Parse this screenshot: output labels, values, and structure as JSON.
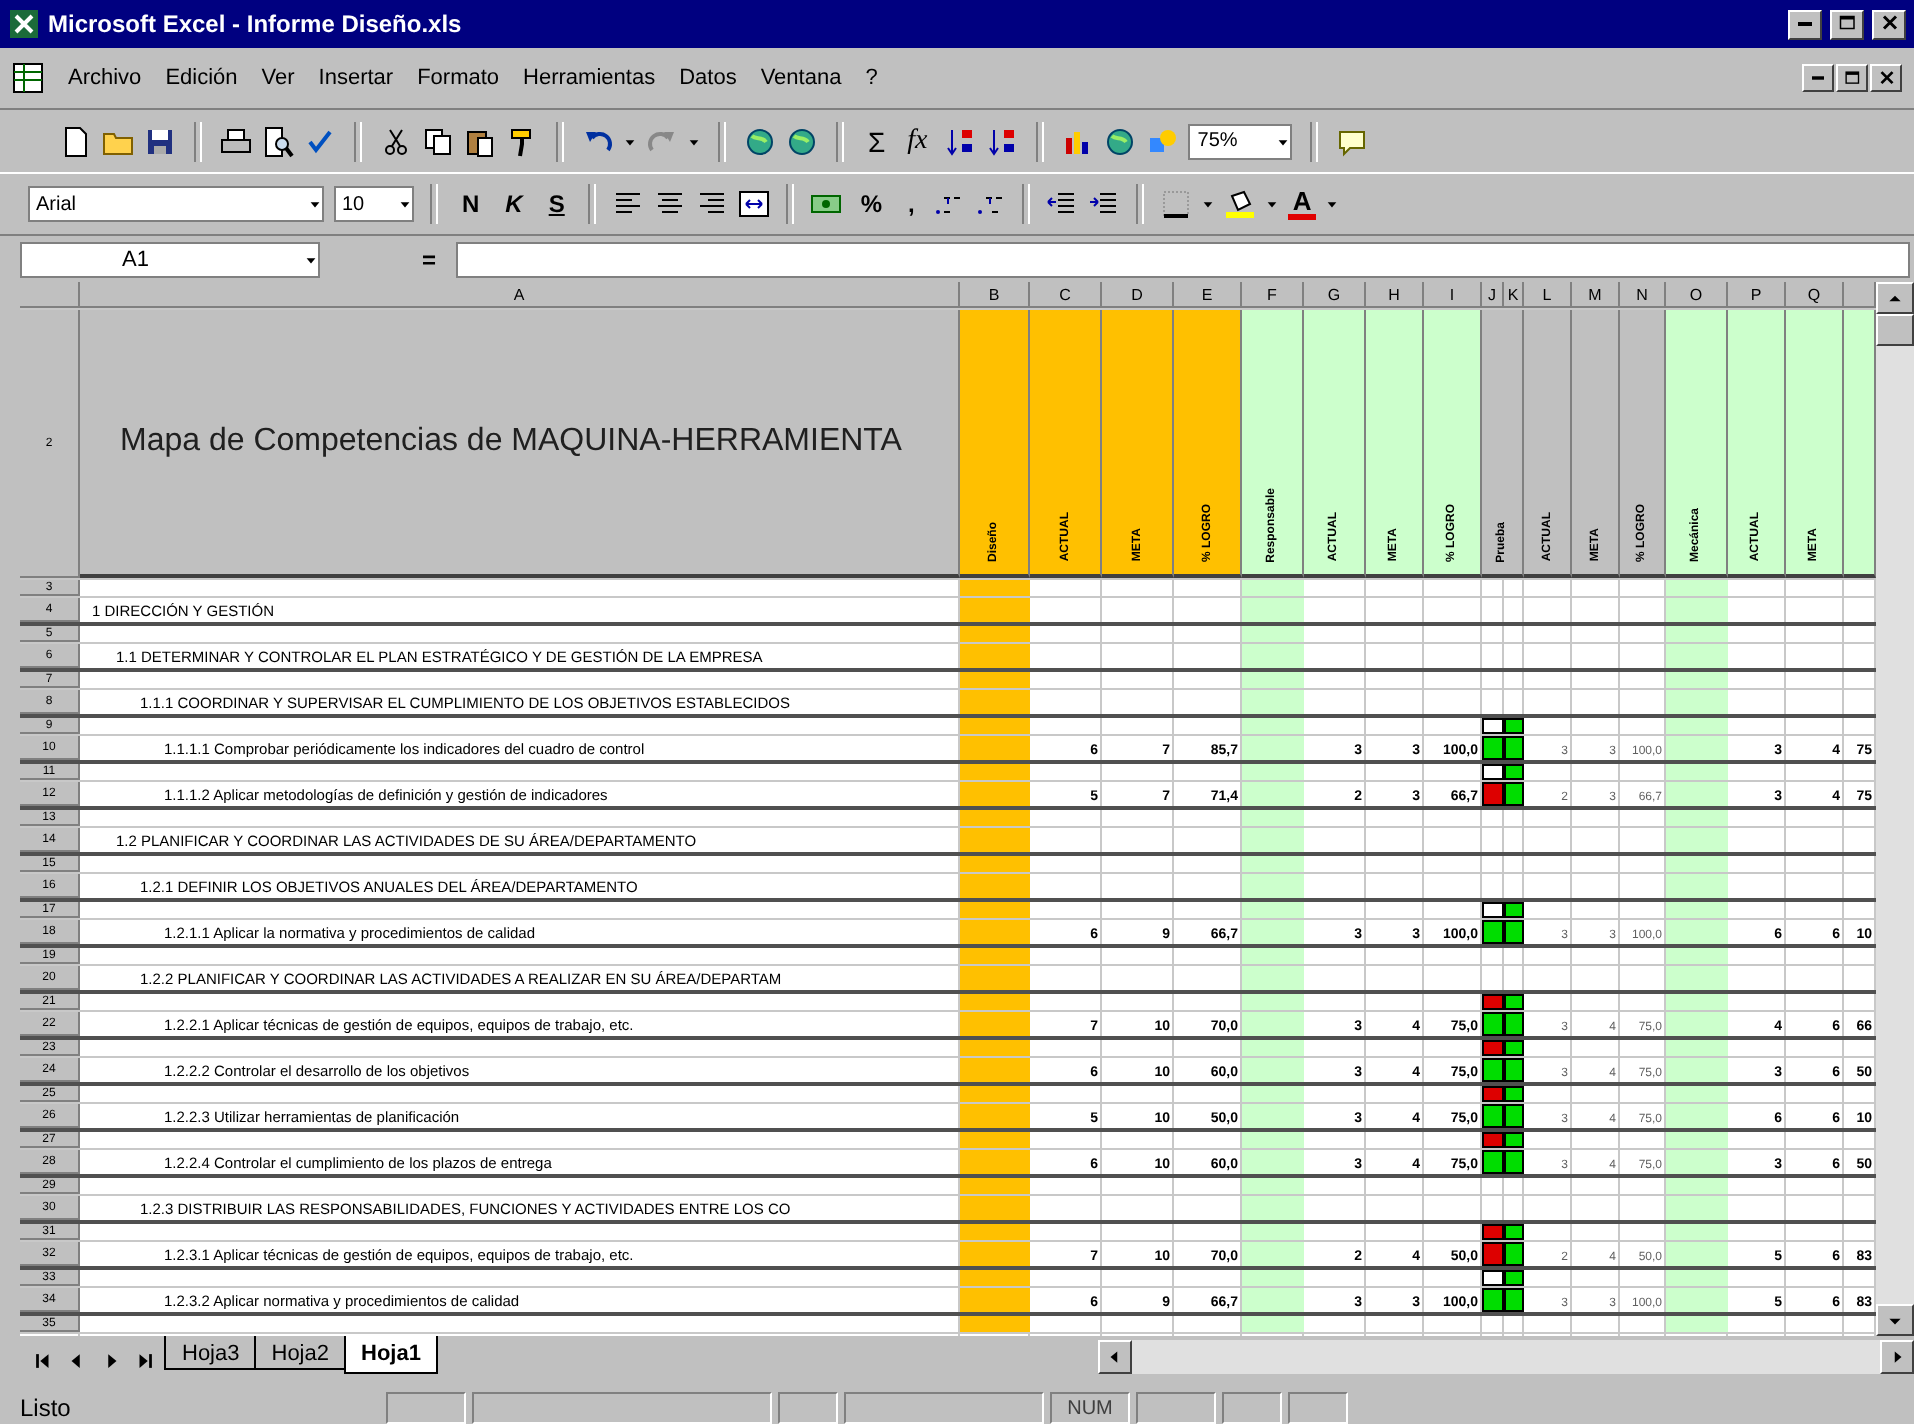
{
  "window": {
    "title": "Microsoft Excel - Informe Diseño.xls"
  },
  "menu": [
    "Archivo",
    "Edición",
    "Ver",
    "Insertar",
    "Formato",
    "Herramientas",
    "Datos",
    "Ventana",
    "?"
  ],
  "standard_toolbar": {
    "sum": "Σ",
    "function": "fx",
    "zoom": "75%"
  },
  "formatting_toolbar": {
    "font": "Arial",
    "size": "10",
    "bold": "N",
    "italic": "K",
    "underline": "S",
    "percent": "%",
    "comma": ",",
    "font_color": "A"
  },
  "formula_bar": {
    "name_box": "A1",
    "equals": "="
  },
  "sheet": {
    "columns": [
      "A",
      "B",
      "C",
      "D",
      "E",
      "F",
      "G",
      "H",
      "I",
      "J",
      "K",
      "L",
      "M",
      "N",
      "O",
      "P",
      "Q"
    ],
    "row_numbers": [
      "2",
      "3",
      "4",
      "5",
      "6",
      "7",
      "8",
      "9",
      "10",
      "11",
      "12",
      "13",
      "14",
      "15",
      "16",
      "17",
      "18",
      "19",
      "20",
      "21",
      "22",
      "23",
      "24",
      "25",
      "26",
      "27",
      "28",
      "29",
      "30",
      "31",
      "32",
      "33",
      "34",
      "35"
    ],
    "title": "Mapa de Competencias de MAQUINA-HERRAMIENTA",
    "headers": [
      {
        "text": "Diseño",
        "color": "#ffc000",
        "shaded": true
      },
      {
        "text": "ACTUAL",
        "color": "#ffc000",
        "shaded": false
      },
      {
        "text": "META",
        "color": "#ffc000",
        "shaded": false
      },
      {
        "text": "% LOGRO",
        "color": "#ffc000",
        "shaded": false
      },
      {
        "text": "Responsable",
        "color": "#ccffcc",
        "shaded": true
      },
      {
        "text": "ACTUAL",
        "color": "#ccffcc",
        "shaded": false
      },
      {
        "text": "META",
        "color": "#ccffcc",
        "shaded": false
      },
      {
        "text": "% LOGRO",
        "color": "#ccffcc",
        "shaded": false
      },
      {
        "text": "Prueba",
        "color": "#c0c0c0",
        "shaded": false
      },
      {
        "text": "ACTUAL",
        "color": "#c0c0c0",
        "shaded": false
      },
      {
        "text": "META",
        "color": "#c0c0c0",
        "shaded": false
      },
      {
        "text": "% LOGRO",
        "color": "#c0c0c0",
        "shaded": false
      },
      {
        "text": "Mecánica",
        "color": "#ccffcc",
        "shaded": true
      },
      {
        "text": "ACTUAL",
        "color": "#ccffcc",
        "shaded": false
      },
      {
        "text": "META",
        "color": "#ccffcc",
        "shaded": false
      },
      {
        "color": "#ccffcc",
        "shaded": false
      }
    ],
    "rows": [
      {
        "label": "1 DIRECCIÓN Y GESTIÓN",
        "children": [
          {
            "label": "1.1 DETERMINAR Y CONTROLAR EL PLAN ESTRATÉGICO Y DE GESTIÓN DE LA EMPRESA",
            "children": [
              {
                "label": "1.1.1 COORDINAR Y SUPERVISAR EL CUMPLIMIENTO DE LOS OBJETIVOS ESTABLECIDOS",
                "children": [
                  {
                    "label": "1.1.1.1 Comprobar periódicamente los indicadores del cuadro de control",
                    "values": [
                      "6",
                      "7",
                      "85,7",
                      "3",
                      "3",
                      "100,0",
                      "3",
                      "3",
                      "100,0",
                      "3",
                      "4",
                      "75"
                    ],
                    "indicator": [
                      {
                        "color": "#ffffff"
                      },
                      {
                        "color": "#00dd00"
                      },
                      {
                        "color": "#00dd00"
                      },
                      {
                        "color": "#00dd00"
                      }
                    ]
                  },
                  {
                    "label": "1.1.1.2 Aplicar metodologías de definición y gestión de indicadores",
                    "values": [
                      "5",
                      "7",
                      "71,4",
                      "2",
                      "3",
                      "66,7",
                      "2",
                      "3",
                      "66,7",
                      "3",
                      "4",
                      "75"
                    ],
                    "indicator": [
                      {
                        "color": "#ffffff"
                      },
                      {
                        "color": "#00dd00"
                      },
                      {
                        "color": "#dd0000"
                      },
                      {
                        "color": "#00dd00"
                      }
                    ]
                  }
                ]
              }
            ]
          },
          {
            "label": "1.2 PLANIFICAR Y COORDINAR LAS ACTIVIDADES DE SU ÁREA/DEPARTAMENTO",
            "children": [
              {
                "label": "1.2.1 DEFINIR LOS OBJETIVOS ANUALES DEL ÁREA/DEPARTAMENTO",
                "children": [
                  {
                    "label": "1.2.1.1 Aplicar la normativa y procedimientos de calidad",
                    "values": [
                      "6",
                      "9",
                      "66,7",
                      "3",
                      "3",
                      "100,0",
                      "3",
                      "3",
                      "100,0",
                      "6",
                      "6",
                      "10"
                    ],
                    "indicator": [
                      {
                        "color": "#ffffff"
                      },
                      {
                        "color": "#00dd00"
                      },
                      {
                        "color": "#00dd00"
                      },
                      {
                        "color": "#00dd00"
                      }
                    ]
                  }
                ]
              },
              {
                "label": "1.2.2 PLANIFICAR Y COORDINAR LAS ACTIVIDADES A REALIZAR EN SU ÁREA/DEPARTAM",
                "children": [
                  {
                    "label": "1.2.2.1 Aplicar técnicas de gestión de equipos, equipos de trabajo, etc.",
                    "values": [
                      "7",
                      "10",
                      "70,0",
                      "3",
                      "4",
                      "75,0",
                      "3",
                      "4",
                      "75,0",
                      "4",
                      "6",
                      "66"
                    ],
                    "indicator": [
                      {
                        "color": "#dd0000"
                      },
                      {
                        "color": "#00dd00"
                      },
                      {
                        "color": "#00dd00"
                      },
                      {
                        "color": "#00dd00"
                      }
                    ]
                  },
                  {
                    "label": "1.2.2.2 Controlar el desarrollo de los objetivos",
                    "values": [
                      "6",
                      "10",
                      "60,0",
                      "3",
                      "4",
                      "75,0",
                      "3",
                      "4",
                      "75,0",
                      "3",
                      "6",
                      "50"
                    ],
                    "indicator": [
                      {
                        "color": "#dd0000"
                      },
                      {
                        "color": "#00dd00"
                      },
                      {
                        "color": "#00dd00"
                      },
                      {
                        "color": "#00dd00"
                      }
                    ]
                  },
                  {
                    "label": "1.2.2.3 Utilizar herramientas de planificación",
                    "values": [
                      "5",
                      "10",
                      "50,0",
                      "3",
                      "4",
                      "75,0",
                      "3",
                      "4",
                      "75,0",
                      "6",
                      "6",
                      "10"
                    ],
                    "indicator": [
                      {
                        "color": "#dd0000"
                      },
                      {
                        "color": "#00dd00"
                      },
                      {
                        "color": "#00dd00"
                      },
                      {
                        "color": "#00dd00"
                      }
                    ]
                  },
                  {
                    "label": "1.2.2.4 Controlar el cumplimiento de los plazos de entrega",
                    "values": [
                      "6",
                      "10",
                      "60,0",
                      "3",
                      "4",
                      "75,0",
                      "3",
                      "4",
                      "75,0",
                      "3",
                      "6",
                      "50"
                    ],
                    "indicator": [
                      {
                        "color": "#dd0000"
                      },
                      {
                        "color": "#00dd00"
                      },
                      {
                        "color": "#00dd00"
                      },
                      {
                        "color": "#00dd00"
                      }
                    ]
                  }
                ]
              },
              {
                "label": "1.2.3 DISTRIBUIR LAS RESPONSABILIDADES, FUNCIONES Y ACTIVIDADES ENTRE LOS CO",
                "children": [
                  {
                    "label": "1.2.3.1 Aplicar técnicas de gestión de equipos, equipos de trabajo, etc.",
                    "values": [
                      "7",
                      "10",
                      "70,0",
                      "2",
                      "4",
                      "50,0",
                      "2",
                      "4",
                      "50,0",
                      "5",
                      "6",
                      "83"
                    ],
                    "indicator": [
                      {
                        "color": "#dd0000"
                      },
                      {
                        "color": "#00dd00"
                      },
                      {
                        "color": "#dd0000"
                      },
                      {
                        "color": "#00dd00"
                      }
                    ]
                  },
                  {
                    "label": "1.2.3.2 Aplicar normativa y procedimientos de calidad",
                    "values": [
                      "6",
                      "9",
                      "66,7",
                      "3",
                      "3",
                      "100,0",
                      "3",
                      "3",
                      "100,0",
                      "5",
                      "6",
                      "83"
                    ],
                    "indicator": [
                      {
                        "color": "#ffffff"
                      },
                      {
                        "color": "#00dd00"
                      },
                      {
                        "color": "#00dd00"
                      },
                      {
                        "color": "#00dd00"
                      }
                    ]
                  }
                ]
              }
            ]
          }
        ]
      }
    ]
  },
  "sheet_tabs": [
    {
      "label": "Hoja3",
      "selected": false
    },
    {
      "label": "Hoja2",
      "selected": false
    },
    {
      "label": "Hoja1",
      "selected": true
    }
  ],
  "status_bar": {
    "text": "Listo",
    "indicators": [
      "NUM"
    ]
  }
}
